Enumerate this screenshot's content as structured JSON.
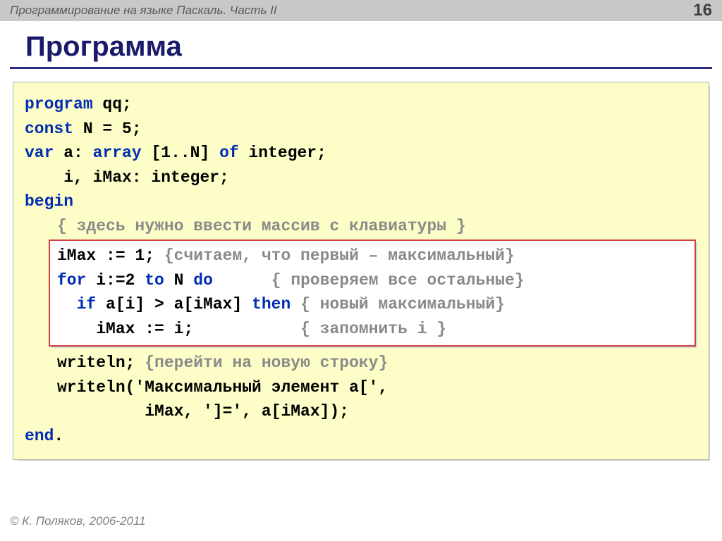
{
  "header": {
    "title": "Программирование на языке Паскаль. Часть II",
    "page": "16"
  },
  "slide": {
    "title": "Программа"
  },
  "code": {
    "l1_kw": "program",
    "l1_rest": " qq;",
    "l2_kw": "const",
    "l2_rest": " N = 5;",
    "l3_kw1": "var",
    "l3_mid": " a: ",
    "l3_kw2": "array",
    "l3_mid2": " [1..N] ",
    "l3_kw3": "of",
    "l3_rest": " integer;",
    "l4": "    i, iMax: integer;",
    "l5_kw": "begin",
    "l6_cm": "{ здесь нужно ввести массив с клавиатуры }",
    "h1_code": "iMax := 1; ",
    "h1_cm": "{считаем, что первый – максимальный}",
    "h2_kw1": "for",
    "h2_mid1": " i:=2 ",
    "h2_kw2": "to",
    "h2_mid2": " N ",
    "h2_kw3": "do",
    "h2_sp": "      ",
    "h2_cm": "{ проверяем все остальные}",
    "h3_sp": "  ",
    "h3_kw": "if",
    "h3_mid": " a[i] > a[iMax] ",
    "h3_kw2": "then",
    "h3_sp2": " ",
    "h3_cm": "{ новый максимальный}",
    "h4_sp": "    ",
    "h4_code": "iMax := i;",
    "h4_sp2": "           ",
    "h4_cm": "{ запомнить i }",
    "l11_code": "writeln; ",
    "l11_cm": "{перейти на новую строку}",
    "l12": "writeln('Максимальный элемент a[',",
    "l13": "         iMax, ']=', a[iMax]);",
    "l14_kw": "end",
    "l14_rest": "."
  },
  "footer": "© К. Поляков, 2006-2011"
}
